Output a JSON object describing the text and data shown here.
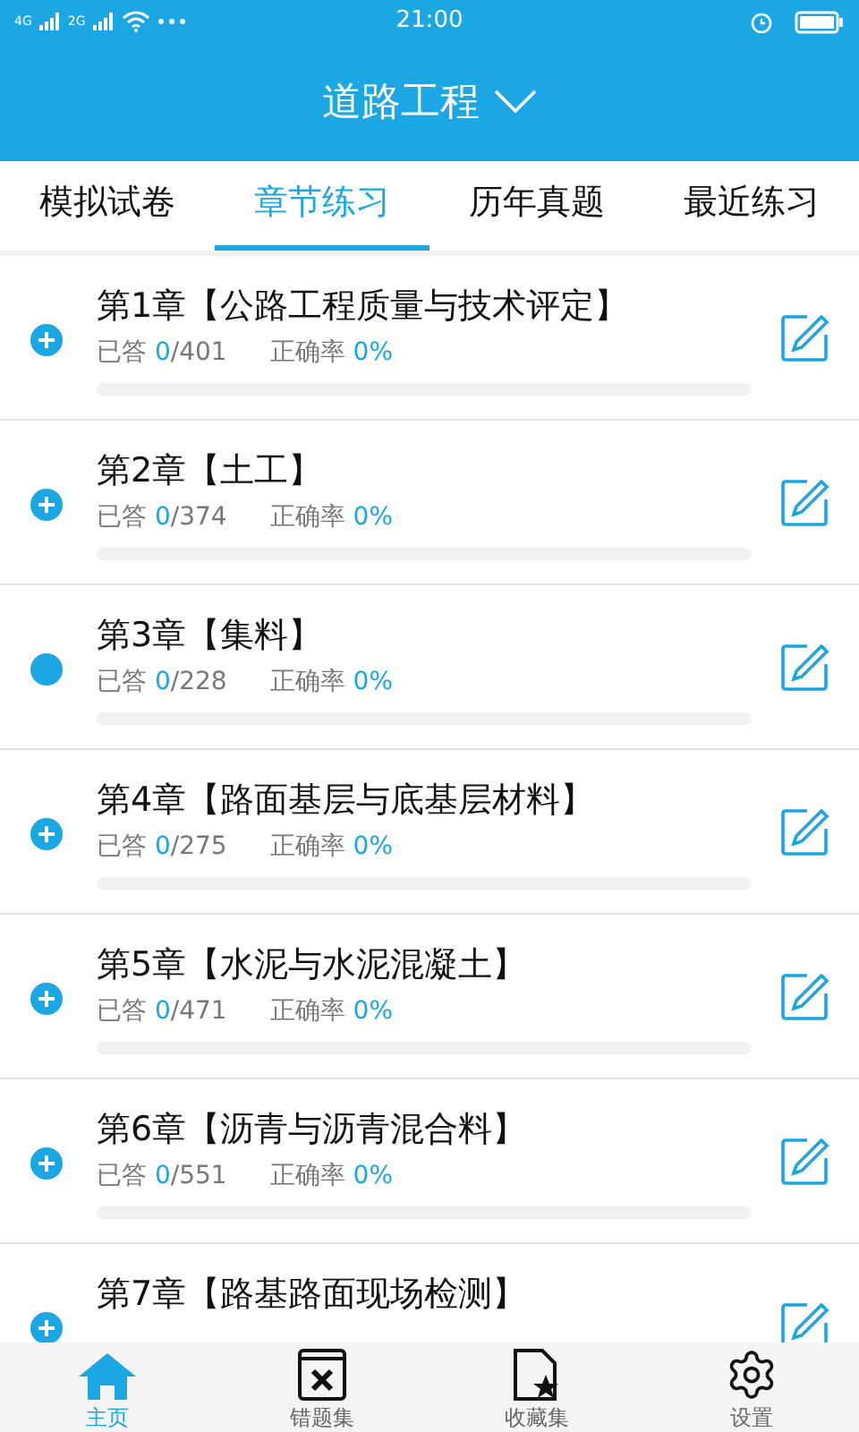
{
  "status_bar": {
    "network_1": "4G",
    "network_2": "2G",
    "time": "21:00"
  },
  "header": {
    "title": "道路工程"
  },
  "tabs": [
    {
      "label": "模拟试卷",
      "selected": false
    },
    {
      "label": "章节练习",
      "selected": true
    },
    {
      "label": "历年真题",
      "selected": false
    },
    {
      "label": "最近练习",
      "selected": false
    }
  ],
  "chapters": [
    {
      "title": "第1章【公路工程质量与技术评定】",
      "expandable": true,
      "answered_label": "已答",
      "answered": "0",
      "total": "/401",
      "accuracy_label": "正确率",
      "accuracy": "0%",
      "level": 0
    },
    {
      "title": "第2章【土工】",
      "expandable": true,
      "answered_label": "已答",
      "answered": "0",
      "total": "/374",
      "accuracy_label": "正确率",
      "accuracy": "0%",
      "level": 0
    },
    {
      "title": "第3章【集料】",
      "expandable": false,
      "answered_label": "已答",
      "answered": "0",
      "total": "/228",
      "accuracy_label": "正确率",
      "accuracy": "0%",
      "level": 0
    },
    {
      "title": "第4章【路面基层与底基层材料】",
      "expandable": true,
      "answered_label": "已答",
      "answered": "0",
      "total": "/275",
      "accuracy_label": "正确率",
      "accuracy": "0%",
      "level": 0
    },
    {
      "title": "第5章【水泥与水泥混凝土】",
      "expandable": true,
      "answered_label": "已答",
      "answered": "0",
      "total": "/471",
      "accuracy_label": "正确率",
      "accuracy": "0%",
      "level": 0
    },
    {
      "title": "第6章【沥青与沥青混合料】",
      "expandable": true,
      "answered_label": "已答",
      "answered": "0",
      "total": "/551",
      "accuracy_label": "正确率",
      "accuracy": "0%",
      "level": 0
    },
    {
      "title": "第7章【路基路面现场检测】",
      "expandable": true
    }
  ],
  "bottom_nav": [
    {
      "label": "主页",
      "kind": "home",
      "selected": true
    },
    {
      "label": "错题集",
      "kind": "mistakes",
      "selected": false
    },
    {
      "label": "收藏集",
      "kind": "favorites",
      "selected": false
    },
    {
      "label": "设置",
      "kind": "settings",
      "selected": false
    }
  ]
}
